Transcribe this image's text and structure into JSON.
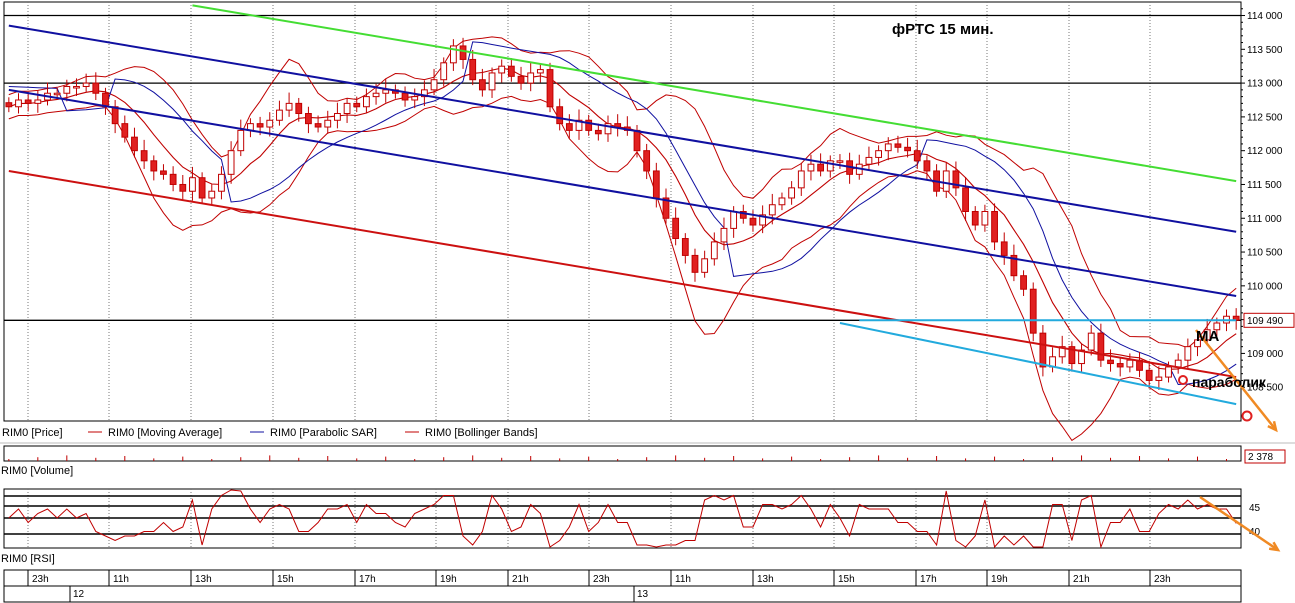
{
  "chart_data": {
    "type": "candlestick",
    "title": "фРТС   15 мин.",
    "price_axis": {
      "ylim": [
        108000,
        114200
      ],
      "ticks": [
        108500,
        109000,
        109500,
        110000,
        110500,
        111000,
        111500,
        112000,
        112500,
        113000,
        113500,
        114000
      ],
      "tick_labels": [
        "108 500",
        "109 000",
        "109 500",
        "110 000",
        "110 500",
        "111 000",
        "111 500",
        "112 000",
        "112 500",
        "113 000",
        "113 500",
        "114 000"
      ],
      "last_price_label": "109 490",
      "last_price": 109490
    },
    "time_axis": {
      "hour_labels": [
        "23h",
        "11h",
        "13h",
        "15h",
        "17h",
        "19h",
        "21h",
        "23h",
        "11h",
        "13h",
        "15h",
        "17h",
        "19h",
        "21h",
        "23h"
      ],
      "date_labels": [
        "12",
        "13"
      ],
      "n_bars": 128
    },
    "candles": {
      "close": [
        112650,
        112750,
        112700,
        112750,
        112850,
        112850,
        112950,
        112950,
        113000,
        112850,
        112650,
        112400,
        112200,
        112000,
        111850,
        111700,
        111650,
        111500,
        111400,
        111600,
        111300,
        111400,
        111650,
        112000,
        112300,
        112400,
        112350,
        112450,
        112600,
        112700,
        112550,
        112400,
        112350,
        112450,
        112550,
        112700,
        112650,
        112800,
        112850,
        112900,
        112850,
        112750,
        112800,
        112900,
        113050,
        113300,
        113550,
        113350,
        113050,
        112900,
        113150,
        113250,
        113100,
        113000,
        113150,
        113200,
        112650,
        112400,
        112300,
        112450,
        112300,
        112250,
        112400,
        112350,
        112300,
        112000,
        111700,
        111300,
        111000,
        110700,
        110450,
        110200,
        110400,
        110650,
        110850,
        111100,
        111000,
        110900,
        111050,
        111200,
        111300,
        111450,
        111700,
        111800,
        111700,
        111850,
        111850,
        111650,
        111800,
        111900,
        112000,
        112100,
        112050,
        112000,
        111850,
        111700,
        111400,
        111700,
        111450,
        111100,
        110900,
        111100,
        110650,
        110450,
        110150,
        109950,
        109300,
        108800,
        108950,
        109100,
        108850,
        109050,
        109300,
        108900,
        108850,
        108800,
        108900,
        108750,
        108600,
        108650,
        108800,
        108900,
        109100,
        109200,
        109350,
        109450,
        109550,
        109490
      ],
      "up_color": "#ffffff",
      "down_color": "#e02020"
    },
    "volume_label": "2 378",
    "rsi": {
      "tick_labels": [
        "45",
        "40"
      ],
      "level_values": [
        45,
        40
      ]
    },
    "legend": [
      {
        "name": "RIM0 [Price]",
        "color": "#c00000"
      },
      {
        "name": "RIM0 [Moving Average]",
        "color": "#c00000"
      },
      {
        "name": "RIM0 [Parabolic SAR]",
        "color": "#1010a0"
      },
      {
        "name": "RIM0 [Bollinger Bands]",
        "color": "#c00000"
      }
    ],
    "panel_labels": {
      "volume": "RIM0 [Volume]",
      "rsi": "RIM0 [RSI]"
    },
    "annotations": [
      {
        "text": "MA"
      },
      {
        "text": "параболик"
      }
    ],
    "horizontal_levels": [
      114000,
      113000,
      109490
    ],
    "trend_lines": [
      {
        "name": "green-resistance",
        "color": "#44dd33",
        "from": {
          "bar": 19,
          "price": 114150
        },
        "to": {
          "bar": 127,
          "price": 111550
        }
      },
      {
        "name": "blue-upper-channel",
        "color": "#1010a0",
        "from": {
          "bar": 0,
          "price": 113850
        },
        "to": {
          "bar": 127,
          "price": 110800
        }
      },
      {
        "name": "blue-lower-channel",
        "color": "#1010a0",
        "from": {
          "bar": 0,
          "price": 112900
        },
        "to": {
          "bar": 127,
          "price": 109850
        }
      },
      {
        "name": "red-support",
        "color": "#cc1010",
        "from": {
          "bar": 0,
          "price": 111700
        },
        "to": {
          "bar": 127,
          "price": 108650
        }
      },
      {
        "name": "cyan-support",
        "color": "#22aadd",
        "from": {
          "bar": 86,
          "price": 109450
        },
        "to": {
          "bar": 127,
          "price": 108250
        }
      },
      {
        "name": "cyan-resistance",
        "color": "#22aadd",
        "from": {
          "bar": 88,
          "price": 109490
        },
        "to": {
          "bar": 127,
          "price": 109490
        }
      }
    ]
  }
}
